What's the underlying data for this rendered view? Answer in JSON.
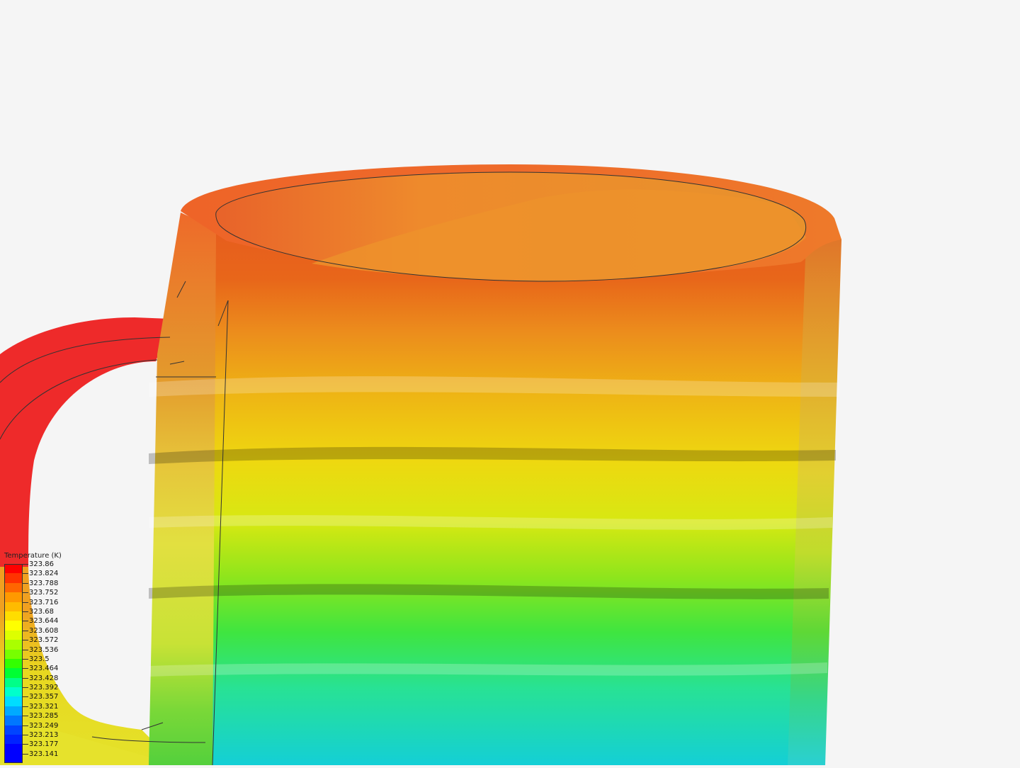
{
  "legend": {
    "title": "Temperature (K)",
    "entries": [
      {
        "label": "323.86",
        "color": "#ff0000"
      },
      {
        "label": "323.824",
        "color": "#ff3300"
      },
      {
        "label": "323.788",
        "color": "#ff6600"
      },
      {
        "label": "323.752",
        "color": "#ff9900"
      },
      {
        "label": "323.716",
        "color": "#ffbb00"
      },
      {
        "label": "323.68",
        "color": "#ffdd00"
      },
      {
        "label": "323.644",
        "color": "#ffff00"
      },
      {
        "label": "323.608",
        "color": "#ddff00"
      },
      {
        "label": "323.572",
        "color": "#aaff00"
      },
      {
        "label": "323.536",
        "color": "#77ff00"
      },
      {
        "label": "323.5",
        "color": "#33ff00"
      },
      {
        "label": "323.464",
        "color": "#00ff33"
      },
      {
        "label": "323.428",
        "color": "#00ff88"
      },
      {
        "label": "323.392",
        "color": "#00ffcc"
      },
      {
        "label": "323.357",
        "color": "#00ddff"
      },
      {
        "label": "323.321",
        "color": "#00aaff"
      },
      {
        "label": "323.285",
        "color": "#0077ff"
      },
      {
        "label": "323.249",
        "color": "#0044ff"
      },
      {
        "label": "323.213",
        "color": "#0022ff"
      },
      {
        "label": "323.177",
        "color": "#0000ff"
      },
      {
        "label": "323.141",
        "color": "#0000ff"
      }
    ]
  },
  "colors": {
    "background": "#f5f5f5",
    "outline": "#333333"
  }
}
